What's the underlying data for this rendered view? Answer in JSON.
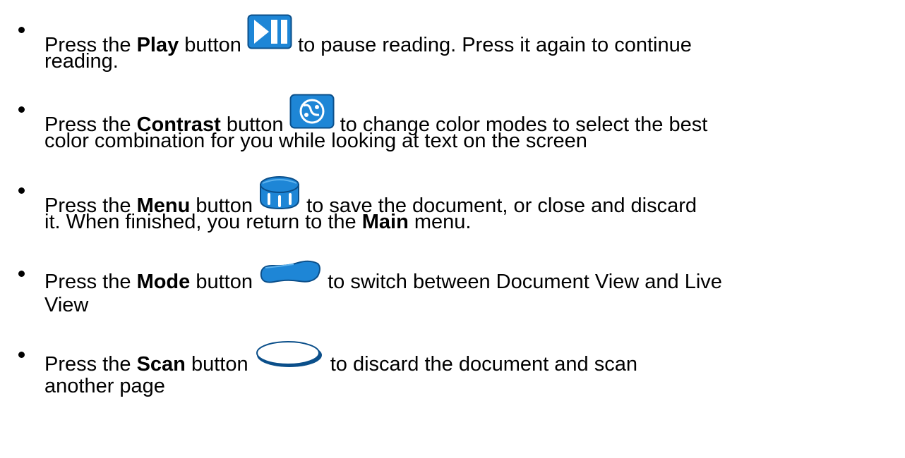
{
  "items": [
    {
      "pre": "Press the ",
      "name": "Play",
      "mid": " button ",
      "post": " to pause reading. Press it again to continue",
      "line2": "reading.",
      "icon": "play-pause-icon"
    },
    {
      "pre": "Press the ",
      "name": "Contrast",
      "mid": " button ",
      "post": " to change color modes to select the best",
      "line2": "color combination for you while looking at text on the screen",
      "icon": "contrast-icon"
    },
    {
      "pre": "Press the ",
      "name": "Menu",
      "mid": " button ",
      "post": " to save the document, or close and discard",
      "line2a": "it. When finished, you return to the ",
      "line2b": "Main",
      "line2c": " menu.",
      "icon": "menu-knob-icon"
    },
    {
      "pre": "Press the ",
      "name": "Mode",
      "mid": " button ",
      "post": " to switch between Document View and Live",
      "line2": "View",
      "icon": "mode-button-icon"
    },
    {
      "pre": "Press the ",
      "name": "Scan",
      "mid": " button ",
      "post": " to discard the document and scan",
      "line2": "another page",
      "icon": "scan-button-icon"
    }
  ],
  "colors": {
    "icon_blue": "#1E86D6",
    "icon_dark": "#0B4F8A",
    "text": "#000000"
  }
}
